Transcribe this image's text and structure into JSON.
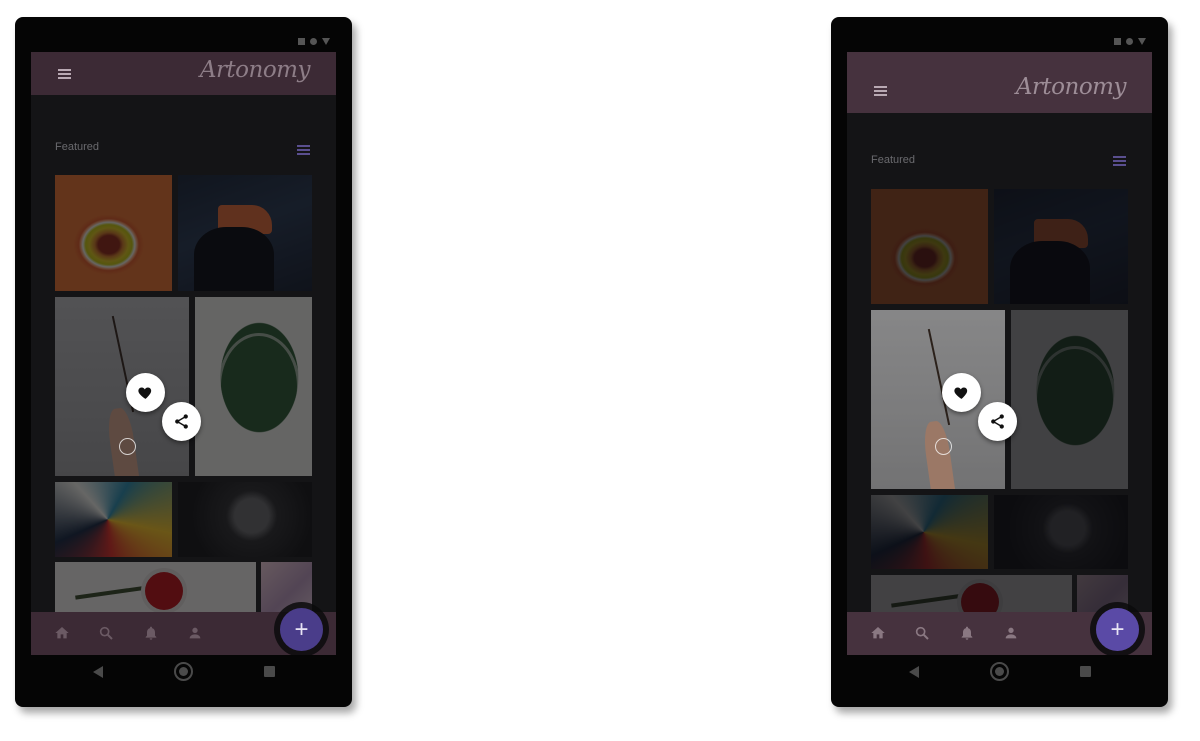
{
  "app": {
    "title": "Artonomy"
  },
  "feed": {
    "section_title": "Featured"
  },
  "icons": {
    "menu": "hamburger-menu-icon",
    "filter": "filter-sliders-icon",
    "like": "heart-icon",
    "share": "share-icon",
    "home": "home-icon",
    "search": "search-icon",
    "notifications": "bell-icon",
    "profile": "person-icon",
    "add": "plus-icon"
  },
  "fab": {
    "add_label": "+"
  },
  "colors": {
    "app_bar": "#3c2a35",
    "accent": "#4a3d8a",
    "filter_icon": "#5a4f8f",
    "screen_bg": "#141416"
  }
}
